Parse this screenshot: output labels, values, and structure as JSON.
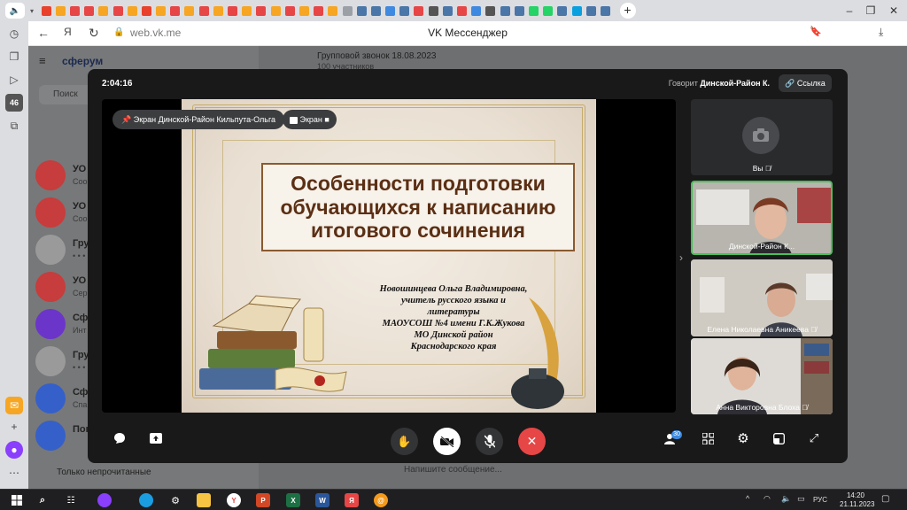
{
  "browser": {
    "url": "web.vk.me",
    "page_title": "VK Мессенджер",
    "tab_icons": [
      "#e8412c",
      "#f6a623",
      "#e64646",
      "#e64646",
      "#f6a623",
      "#e64646",
      "#f6a623",
      "#e8412c",
      "#f6a623",
      "#e64646",
      "#f6a623",
      "#e64646",
      "#f6a623",
      "#e64646",
      "#f6a623",
      "#e64646",
      "#f6a623",
      "#e64646",
      "#f6a623",
      "#e64646",
      "#f6a623",
      "#9aa0a6",
      "#4a76a8",
      "#4a76a8",
      "#3f8ae0",
      "#4a76a8",
      "#e64646",
      "#555",
      "#4a76a8",
      "#e64646",
      "#3f8ae0",
      "#555",
      "#4a76a8",
      "#4a76a8",
      "#25d366",
      "#25d366",
      "#4a76a8",
      "#0aa0e0",
      "#4a76a8",
      "#4a76a8"
    ],
    "sidebar_badge": "46"
  },
  "vk": {
    "logo": "сферум",
    "search_placeholder": "Поиск",
    "only_unread": "Только непрочитанные",
    "call_title": "Групповой звонок 18.08.2023",
    "call_members": "100 участников",
    "message_placeholder": "Напишите сообщение...",
    "chats": [
      {
        "name": "УО",
        "sub": "Соо",
        "color": "#c73c3c"
      },
      {
        "name": "УО",
        "sub": "Соо",
        "color": "#c73c3c"
      },
      {
        "name": "Груп",
        "sub": "• • •",
        "color": "#9a9a9a"
      },
      {
        "name": "УО",
        "sub": "Серг",
        "color": "#c73c3c"
      },
      {
        "name": "Сфе",
        "sub": "Инт",
        "color": "#6b35c9"
      },
      {
        "name": "Груп",
        "sub": "• • •",
        "color": "#9a9a9a"
      },
      {
        "name": "Сфе",
        "sub": "Спа",
        "color": "#3560c9"
      },
      {
        "name": "Пок",
        "sub": "",
        "color": "#3560c9"
      }
    ]
  },
  "call": {
    "timer": "2:04:16",
    "speaking_label": "Говорит",
    "speaking_name": "Динской-Район К.",
    "link_button": "Ссылка",
    "screen_pill": "Экран Динской-Район Кильпута-Ольга",
    "share_pill": "Экран",
    "participants_count": "30",
    "participants": [
      {
        "name": "Вы"
      },
      {
        "name": "Динской-Район К..."
      },
      {
        "name": "Елена Николаевна Аникеева"
      },
      {
        "name": "Анна Викторовна Блоха"
      }
    ]
  },
  "slide": {
    "title": "Особенности подготовки обучающихся к написанию итогового сочинения",
    "author_lines": [
      "Новошинцева Ольга Владимировна,",
      "учитель русского языка и",
      "литературы",
      "МАОУСОШ №4 имени Г.К.Жукова",
      "МО Динской район",
      "Краснодарского края"
    ]
  },
  "taskbar": {
    "lang": "РУС",
    "time": "14:20",
    "date": "21.11.2023"
  }
}
